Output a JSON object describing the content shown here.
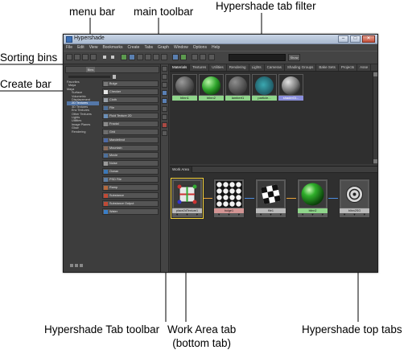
{
  "callouts": {
    "menu_bar": "menu bar",
    "main_toolbar": "main toolbar",
    "hypershade_tab_filter": "Hypershade tab filter",
    "sorting_bins": "Sorting bins",
    "create_bar": "Create bar",
    "hypershade_tab_toolbar": "Hypershade Tab toolbar",
    "work_area_tab_line1": "Work Area tab",
    "work_area_tab_line2": "(bottom tab)",
    "hypershade_top_tabs": "Hypershade top tabs"
  },
  "window": {
    "title": "Hypershade",
    "menu": [
      "File",
      "Edit",
      "View",
      "Bookmarks",
      "Create",
      "Tabs",
      "Graph",
      "Window",
      "Options",
      "Help"
    ],
    "filter_button": "Show",
    "left_tab": "Bins"
  },
  "tree": [
    {
      "label": "Favorites",
      "level": 0,
      "selected": false
    },
    {
      "label": "Maya",
      "level": 1,
      "selected": false
    },
    {
      "label": "Maya",
      "level": 0,
      "selected": false
    },
    {
      "label": "Surface",
      "level": 2,
      "selected": false
    },
    {
      "label": "Volumetric",
      "level": 2,
      "selected": false
    },
    {
      "label": "Displacement",
      "level": 2,
      "selected": false
    },
    {
      "label": "2D Textures",
      "level": 2,
      "selected": true
    },
    {
      "label": "3D Textures",
      "level": 2,
      "selected": false
    },
    {
      "label": "Env Textures",
      "level": 2,
      "selected": false
    },
    {
      "label": "Other Textures",
      "level": 2,
      "selected": false
    },
    {
      "label": "Lights",
      "level": 2,
      "selected": false
    },
    {
      "label": "Utilities",
      "level": 2,
      "selected": false
    },
    {
      "label": "Image Planes",
      "level": 2,
      "selected": false
    },
    {
      "label": "Glow",
      "level": 2,
      "selected": false
    },
    {
      "label": "Rendering",
      "level": 2,
      "selected": false
    }
  ],
  "create_items": [
    {
      "label": "Bulge",
      "color": "#7a7a7a"
    },
    {
      "label": "Checker",
      "color": "#e6e6e6"
    },
    {
      "label": "Cloth",
      "color": "#9aa0a8"
    },
    {
      "label": "File",
      "color": "#4d6f9a"
    },
    {
      "label": "Fluid Texture 2D",
      "color": "#6a8fb8"
    },
    {
      "label": "Fractal",
      "color": "#8b8b8b"
    },
    {
      "label": "Grid",
      "color": "#6e6e6e"
    },
    {
      "label": "Mandelbrot",
      "color": "#4e6aa6"
    },
    {
      "label": "Mountain",
      "color": "#8a6b5a"
    },
    {
      "label": "Movie",
      "color": "#4d6f9a"
    },
    {
      "label": "Noise",
      "color": "#9b9b9b"
    },
    {
      "label": "Ocean",
      "color": "#3c78b8"
    },
    {
      "label": "PSD File",
      "color": "#5f7ea3"
    },
    {
      "label": "Ramp",
      "color": "#b46a3f"
    },
    {
      "label": "Substance",
      "color": "#c04a36"
    },
    {
      "label": "Substance Output",
      "color": "#c04a36"
    },
    {
      "label": "Water",
      "color": "#3a7ec8"
    }
  ],
  "top_tabs": [
    "Materials",
    "Textures",
    "Utilities",
    "Rendering",
    "Lights",
    "Cameras",
    "Shading Groups",
    "Bake Sets",
    "Projects",
    "Asse"
  ],
  "swatches": [
    {
      "name": "blinn1",
      "ball": "radial-gradient(circle at 35% 30%, #9a9a9a, #3d3d3d 70%)",
      "label_color": "green"
    },
    {
      "name": "blinn2",
      "ball": "radial-gradient(circle at 35% 30%, #b8f5a6, #2fa52c 45%, #0e4a0c 80%)",
      "label_color": "green"
    },
    {
      "name": "lambert1",
      "ball": "radial-gradient(circle at 35% 30%, #8e8e8e, #3a3a3a 75%)",
      "label_color": "green"
    },
    {
      "name": "particle...",
      "ball": "radial-gradient(circle at 45% 45%, #3aa8b0, #205b66 70%)",
      "label_color": "green"
    },
    {
      "name": "shaderGl...",
      "ball": "radial-gradient(circle at 35% 30%, #e2e2e2, #7a7a7a 50%, #2b2b2b 80%)",
      "label_color": "blue"
    }
  ],
  "work_area": {
    "tab": "Work Area",
    "nodes": [
      {
        "name": "place2dTexture1",
        "label_color": "gray"
      },
      {
        "name": "bulge1",
        "label_color": "pink"
      },
      {
        "name": "file1",
        "label_color": "gray"
      },
      {
        "name": "blinn2",
        "label_color": "green"
      },
      {
        "name": "blinn2SG",
        "label_color": "gray"
      }
    ],
    "port_glyph": "▼"
  }
}
